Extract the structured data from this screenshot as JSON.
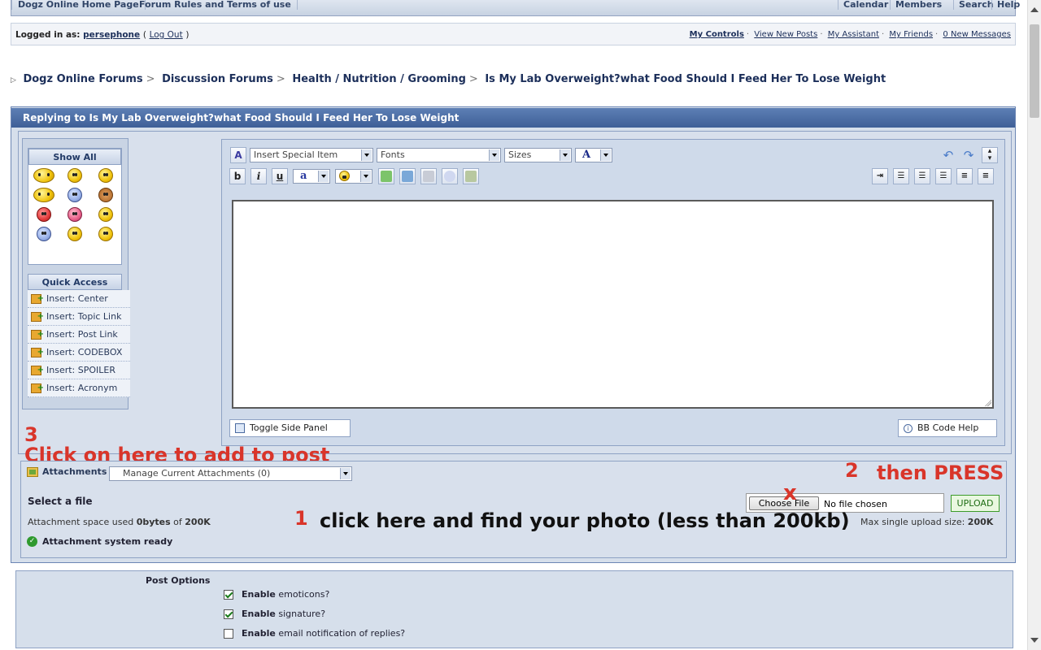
{
  "topbar": {
    "left": [
      "Dogz Online Home Page",
      "Forum Rules and Terms of use"
    ],
    "right": [
      "Calendar",
      "Members",
      "Search",
      "Help"
    ]
  },
  "userbar": {
    "logged_in_label": "Logged in as:",
    "username": "persephone",
    "logout": "Log Out",
    "links": [
      "My Controls",
      "View New Posts",
      "My Assistant",
      "My Friends",
      "0 New Messages"
    ]
  },
  "breadcrumb": [
    "Dogz Online Forums",
    "Discussion Forums",
    "Health / Nutrition / Grooming",
    "Is My Lab Overweight?what Food Should I Feed Her To Lose Weight"
  ],
  "reply_title": "Replying to Is My Lab Overweight?what Food Should I Feed Her To Lose Weight",
  "side": {
    "show_all": "Show All",
    "quick_access": "Quick Access",
    "quick_items": [
      "Insert: Center",
      "Insert: Topic Link",
      "Insert: Post Link",
      "Insert: CODEBOX",
      "Insert: SPOILER",
      "Insert: Acronym"
    ]
  },
  "editor": {
    "special_item": "Insert Special Item",
    "fonts": "Fonts",
    "sizes": "Sizes",
    "bold": "b",
    "italic": "i",
    "underline": "u",
    "font_color_glyph": "A",
    "text_color_glyph": "a",
    "toggle_side_panel": "Toggle Side Panel",
    "bb_code_help": "BB Code Help"
  },
  "attachments": {
    "label": "Attachments",
    "manage": "Manage Current Attachments (0)",
    "select_file": "Select a file",
    "choose_file": "Choose File",
    "no_file": "No file chosen",
    "upload": "UPLOAD",
    "space_prefix": "Attachment space used",
    "space_used": "0bytes",
    "space_of": "of",
    "space_total": "200K",
    "max_label": "Max single upload size:",
    "max_size": "200K",
    "status": "Attachment system ready"
  },
  "annotations": {
    "num3": "3",
    "step3": "Click on here to add to post",
    "num2": "2",
    "step2": "then PRESS",
    "num1": "1",
    "step1": "click here and find your photo (less than 200kb)",
    "mark": "x"
  },
  "post_options": {
    "title": "Post Options",
    "items": [
      {
        "bold": "Enable",
        "rest": "emoticons?",
        "checked": true
      },
      {
        "bold": "Enable",
        "rest": "signature?",
        "checked": true
      },
      {
        "bold": "Enable",
        "rest": "email notification of replies?",
        "checked": false
      }
    ]
  }
}
